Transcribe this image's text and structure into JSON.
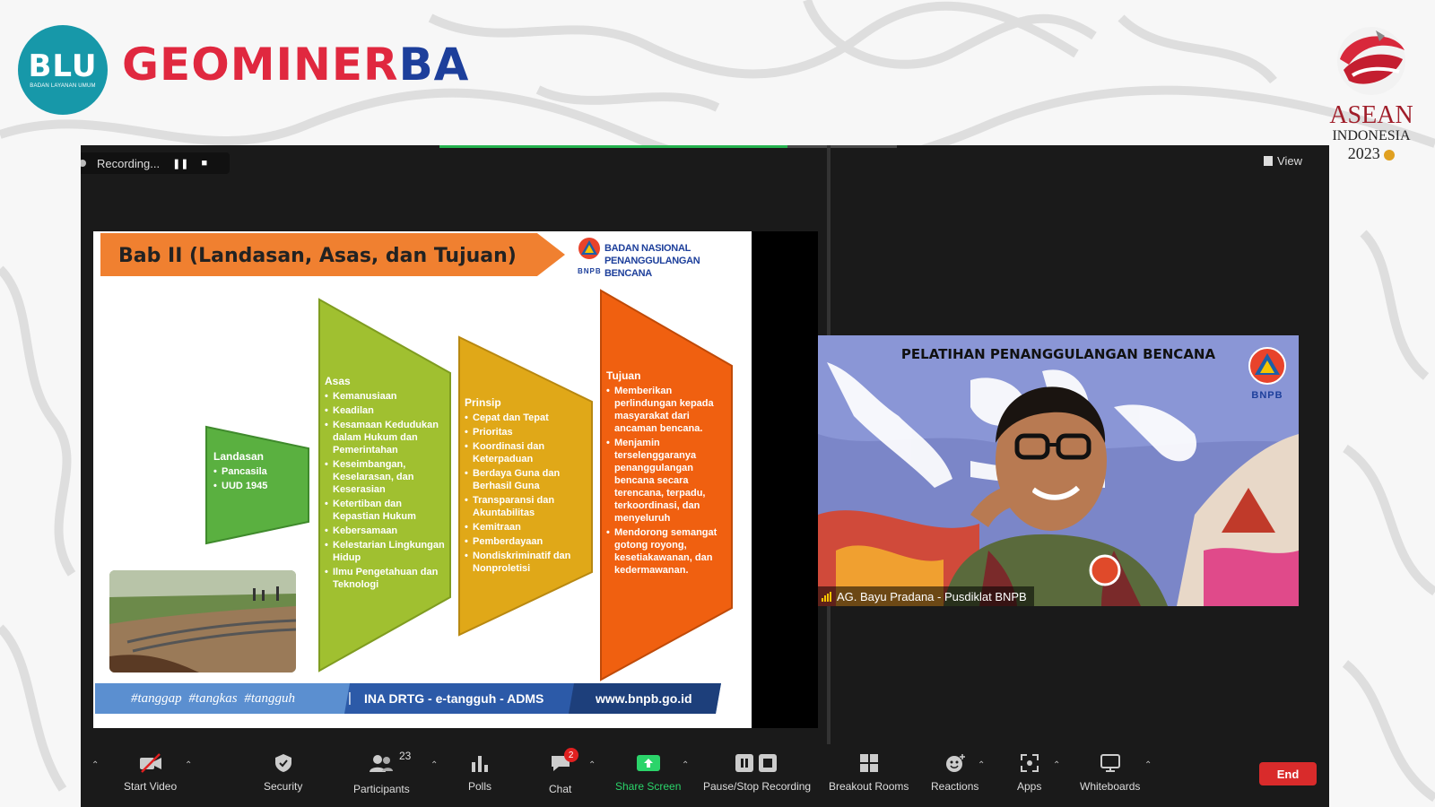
{
  "branding": {
    "blu_text": "BLU",
    "blu_subtext": "BADAN LAYANAN UMUM",
    "geo_red": "GEOMINER",
    "geo_blue": "BA",
    "asean_word": "ASEAN",
    "asean_country": "INDONESIA",
    "asean_year": "2023"
  },
  "zoom": {
    "recording_label": "Recording...",
    "view_label": "View",
    "share_progress": 0.76
  },
  "slide": {
    "title": "Bab II (Landasan, Asas, dan Tujuan)",
    "org_line1": "BADAN NASIONAL",
    "org_line2": "PENANGGULANGAN BENCANA",
    "org_short": "BNPB",
    "columns": {
      "landasan": {
        "title": "Landasan",
        "items": [
          "Pancasila",
          "UUD 1945"
        ]
      },
      "asas": {
        "title": "Asas",
        "items": [
          "Kemanusiaan",
          "Keadilan",
          "Kesamaan Kedudukan dalam Hukum dan Pemerintahan",
          "Keseimbangan, Keselarasan, dan Keserasian",
          "Ketertiban dan Kepastian Hukum",
          "Kebersamaan",
          "Kelestarian Lingkungan Hidup",
          "Ilmu Pengetahuan dan Teknologi"
        ]
      },
      "prinsip": {
        "title": "Prinsip",
        "items": [
          "Cepat dan Tepat",
          "Prioritas",
          "Koordinasi dan Keterpaduan",
          "Berdaya Guna dan Berhasil Guna",
          "Transparansi dan Akuntabilitas",
          "Kemitraan",
          "Pemberdayaan",
          "Nondiskriminatif dan Nonproletisi"
        ]
      },
      "tujuan": {
        "title": "Tujuan",
        "items": [
          "Memberikan perlindungan kepada masyarakat dari ancaman bencana.",
          "Menjamin terselenggaranya penanggulangan bencana secara terencana, terpadu, terkoordinasi, dan menyeluruh",
          "Mendorong semangat gotong royong, kesetiakawanan, dan kedermawanan."
        ]
      }
    },
    "footer_tags": "#tanggap  #tangkas  #tangguh",
    "footer_sep": "|",
    "footer_systems": "INA DRTG - e-tangguh - ADMS",
    "footer_web": "www.bnpb.go.id"
  },
  "video": {
    "banner": "PELATIHAN PENANGGULANGAN BENCANA",
    "logo_text": "BNPB",
    "participant_name": "AG. Bayu Pradana - Pusdiklat BNPB"
  },
  "toolbar": {
    "start_video": "Start Video",
    "security": "Security",
    "participants": "Participants",
    "participants_count": "23",
    "polls": "Polls",
    "chat": "Chat",
    "chat_badge": "2",
    "share_screen": "Share Screen",
    "pause_recording": "Pause/Stop Recording",
    "breakout_rooms": "Breakout Rooms",
    "reactions": "Reactions",
    "apps": "Apps",
    "whiteboards": "Whiteboards",
    "end": "End"
  },
  "colors": {
    "zoom_bg": "#1a1a1a",
    "share_green": "#2bd46a",
    "end_red": "#d92b2b",
    "slide_orange": "#f08030",
    "asas_green": "#a0c030",
    "prinsip_gold": "#e0a818",
    "tujuan_orange": "#f06010",
    "landasan_green": "#5ab040"
  }
}
